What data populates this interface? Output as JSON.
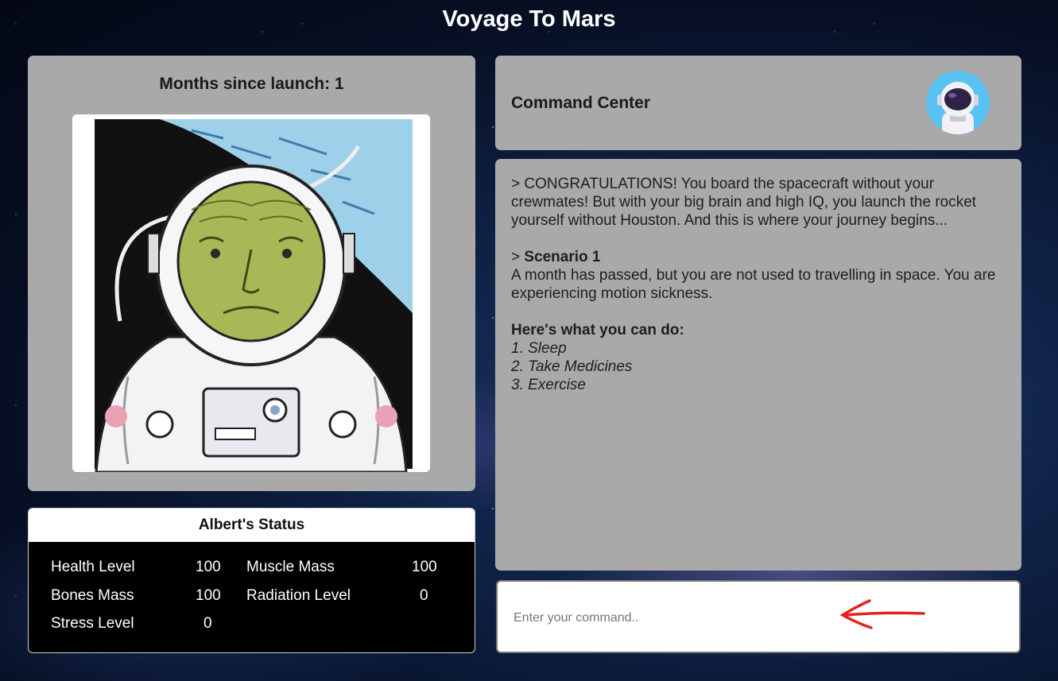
{
  "app": {
    "title": "Voyage To Mars"
  },
  "months_panel": {
    "label": "Months since launch: 1"
  },
  "status": {
    "title": "Albert's Status",
    "items": [
      {
        "label": "Health Level",
        "value": "100"
      },
      {
        "label": "Muscle Mass",
        "value": "100"
      },
      {
        "label": "Bones Mass",
        "value": "100"
      },
      {
        "label": "Radiation Level",
        "value": "0"
      },
      {
        "label": "Stress Level",
        "value": "0"
      }
    ]
  },
  "command_center": {
    "title": "Command Center",
    "avatar_icon": "astronaut-icon"
  },
  "log": {
    "intro": "> CONGRATULATIONS! You board the spacecraft without your crewmates! But with your big brain and high IQ, you launch the rocket yourself without Houston. And this is where your journey begins...",
    "scenario_prefix": "> ",
    "scenario_title": "Scenario 1",
    "scenario_text": "A month has passed, but you are not used to travelling in space. You are experiencing motion sickness.",
    "options_heading": "Here's what you can do:",
    "options": [
      "1. Sleep",
      "2. Take Medicines",
      "3. Exercise"
    ]
  },
  "command_input": {
    "placeholder": "Enter your command..",
    "value": ""
  },
  "colors": {
    "panel_bg": "#a9a9aa",
    "status_bg": "#000000",
    "avatar_bg": "#5ac2f2",
    "arrow": "#e0231f"
  }
}
